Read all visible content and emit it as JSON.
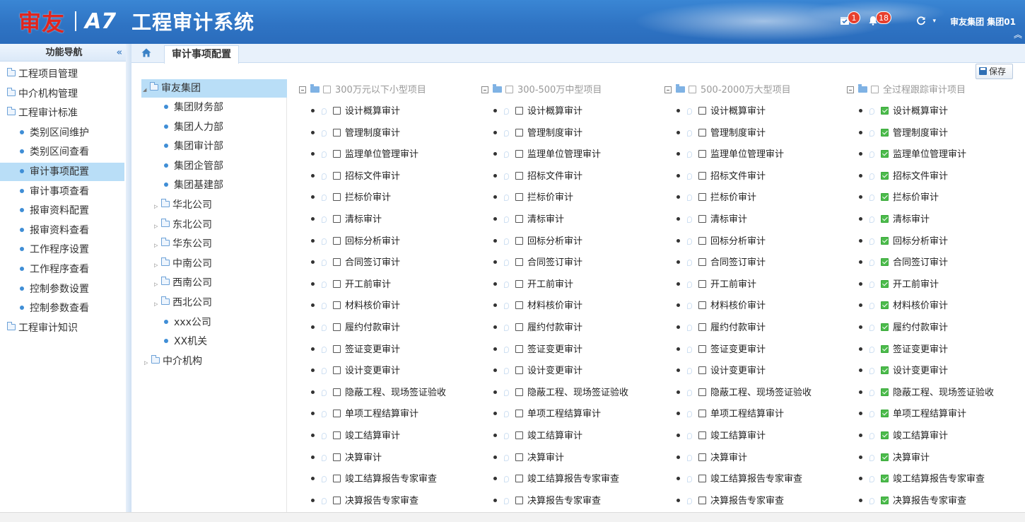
{
  "header": {
    "brand_cn": "审友",
    "brand_a7": "A7",
    "system_title": "工程审计系统",
    "calendar_badge": "1",
    "bell_badge": "18",
    "user_text": "审友集团  集团01"
  },
  "sidebar": {
    "title": "功能导航",
    "collapse_glyph": "«",
    "items": [
      {
        "label": "工程项目管理",
        "level": "top",
        "icon": "folder-icon"
      },
      {
        "label": "中介机构管理",
        "level": "top",
        "icon": "folder-icon"
      },
      {
        "label": "工程审计标准",
        "level": "top",
        "icon": "folder-open-icon"
      },
      {
        "label": "类别区间维护",
        "level": "sub"
      },
      {
        "label": "类别区间查看",
        "level": "sub"
      },
      {
        "label": "审计事项配置",
        "level": "sub",
        "active": true
      },
      {
        "label": "审计事项查看",
        "level": "sub"
      },
      {
        "label": "报审资料配置",
        "level": "sub"
      },
      {
        "label": "报审资料查看",
        "level": "sub"
      },
      {
        "label": "工作程序设置",
        "level": "sub"
      },
      {
        "label": "工作程序查看",
        "level": "sub"
      },
      {
        "label": "控制参数设置",
        "level": "sub"
      },
      {
        "label": "控制参数查看",
        "level": "sub"
      },
      {
        "label": "工程审计知识",
        "level": "top",
        "icon": "folder-icon"
      }
    ]
  },
  "tabs": {
    "active_label": "审计事项配置"
  },
  "toolbar": {
    "save_label": "保存"
  },
  "org_tree": {
    "root": "审友集团",
    "children": [
      {
        "label": "集团财务部",
        "type": "leaf"
      },
      {
        "label": "集团人力部",
        "type": "leaf"
      },
      {
        "label": "集团审计部",
        "type": "leaf"
      },
      {
        "label": "集团企管部",
        "type": "leaf"
      },
      {
        "label": "集团基建部",
        "type": "leaf"
      },
      {
        "label": "华北公司",
        "type": "folder"
      },
      {
        "label": "东北公司",
        "type": "folder"
      },
      {
        "label": "华东公司",
        "type": "folder"
      },
      {
        "label": "中南公司",
        "type": "folder"
      },
      {
        "label": "西南公司",
        "type": "folder"
      },
      {
        "label": "西北公司",
        "type": "folder"
      },
      {
        "label": "xxx公司",
        "type": "leaf"
      },
      {
        "label": "XX机关",
        "type": "leaf"
      }
    ],
    "last": "中介机构"
  },
  "audit_columns": [
    {
      "title": "300万元以下小型项目",
      "checked": false
    },
    {
      "title": "300-500万中型项目",
      "checked": false
    },
    {
      "title": "500-2000万大型项目",
      "checked": false
    },
    {
      "title": "全过程跟踪审计项目",
      "checked": true
    }
  ],
  "audit_items": [
    "设计概算审计",
    "管理制度审计",
    "监理单位管理审计",
    "招标文件审计",
    "拦标价审计",
    "清标审计",
    "回标分析审计",
    "合同签订审计",
    "开工前审计",
    "材料核价审计",
    "履约付款审计",
    "签证变更审计",
    "设计变更审计",
    "隐蔽工程、现场签证验收",
    "单项工程结算审计",
    "竣工结算审计",
    "决算审计",
    "竣工结算报告专家审查",
    "决算报告专家审查"
  ]
}
